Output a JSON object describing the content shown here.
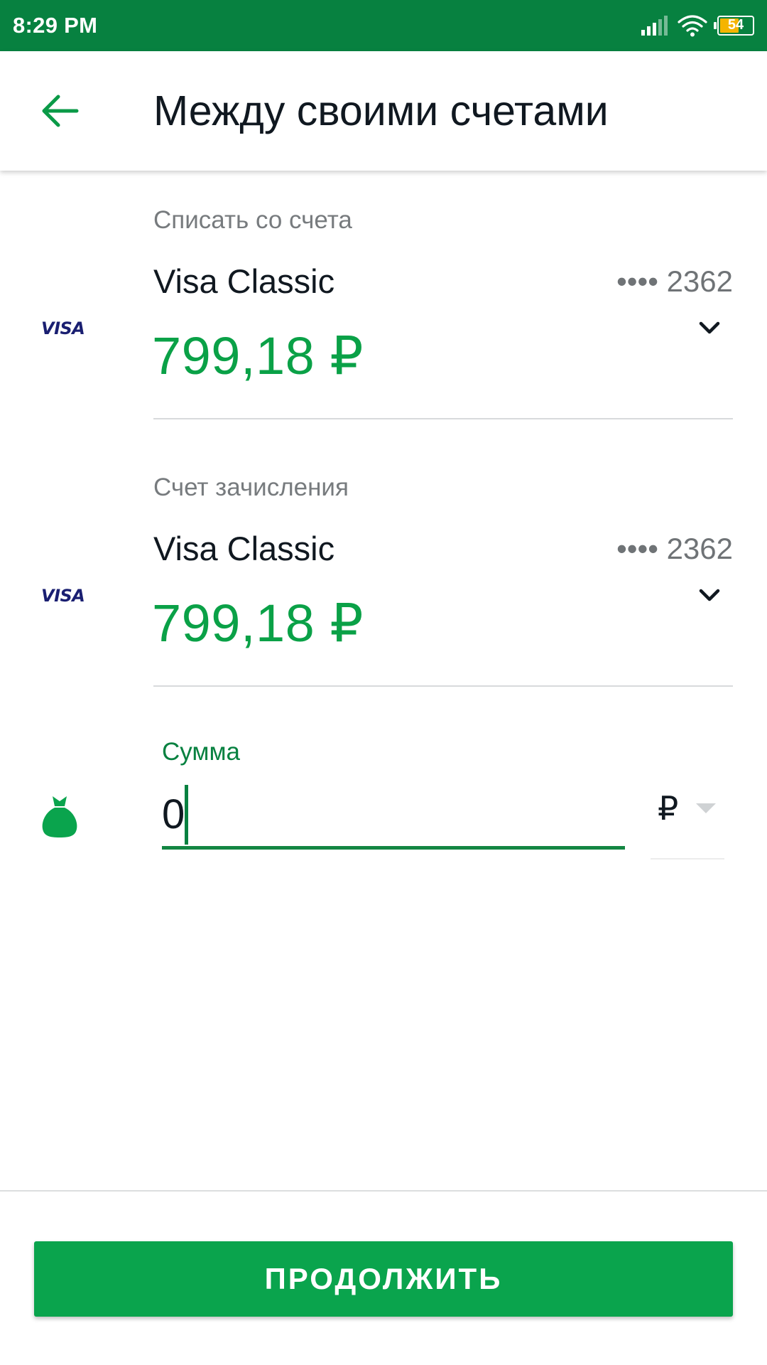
{
  "status_bar": {
    "time": "8:29 PM",
    "battery": "54",
    "icons": [
      "signal-icon",
      "wifi-icon",
      "battery-icon"
    ]
  },
  "header": {
    "title": "Между своими счетами",
    "back_icon": "arrow-left-icon"
  },
  "from_account": {
    "caption": "Списать со счета",
    "card_brand": "VISA",
    "card_name": "Visa Classic",
    "card_number": "•••• 2362",
    "balance": "799,18 ₽"
  },
  "to_account": {
    "caption": "Счет зачисления",
    "card_brand": "VISA",
    "card_name": "Visa Classic",
    "card_number": "•••• 2362",
    "balance": "799,18 ₽"
  },
  "amount": {
    "label": "Сумма",
    "value": "0",
    "currency": "₽"
  },
  "footer": {
    "continue_label": "ПРОДОЛЖИТЬ"
  },
  "colors": {
    "status_bar": "#078140",
    "accent_green": "#0aa147",
    "button_green": "#0aa44d",
    "visa_blue": "#1a1f71"
  }
}
